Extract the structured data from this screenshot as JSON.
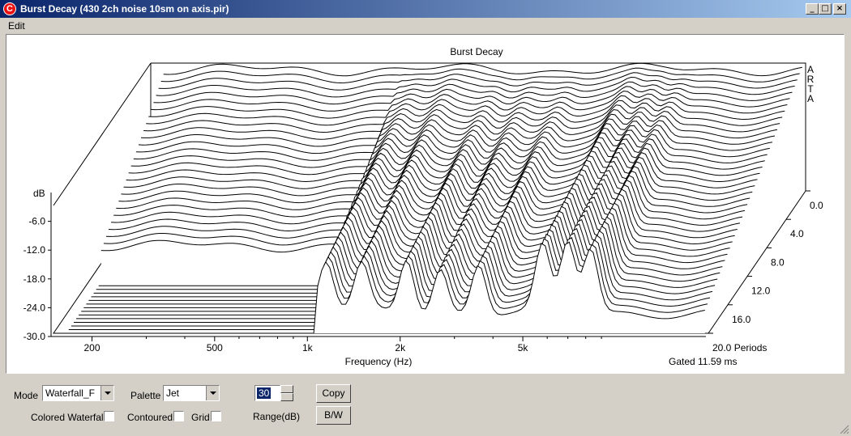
{
  "window": {
    "title": "Burst Decay  (430 2ch noise 10sm on axis.pir)",
    "icon_letter": "C",
    "minimize_glyph": "_",
    "maximize_glyph": "□",
    "close_glyph": "×"
  },
  "menu": {
    "edit": "Edit"
  },
  "chart_data": {
    "type": "waterfall",
    "title": "Burst Decay",
    "brand": [
      "A",
      "R",
      "T",
      "A"
    ],
    "ylabel": "dB",
    "xlabel": "Frequency (Hz)",
    "zlabel": "Periods",
    "gated_note": "Gated 11.59 ms",
    "y_ticks": [
      "-6.0",
      "-12.0",
      "-18.0",
      "-24.0",
      "-30.0"
    ],
    "y_values": [
      -6,
      -12,
      -18,
      -24,
      -30
    ],
    "ylim": [
      -30,
      0
    ],
    "x_scale": "log",
    "x_ticks": [
      "200",
      "500",
      "1k",
      "2k",
      "5k"
    ],
    "x_tick_values": [
      200,
      500,
      1000,
      2000,
      5000
    ],
    "z_ticks": [
      "0.0",
      "4.0",
      "8.0",
      "12.0",
      "16.0",
      "20.0"
    ],
    "z_values": [
      0,
      4,
      8,
      12,
      16,
      20
    ],
    "slices": 40
  },
  "controls": {
    "mode_label": "Mode",
    "mode_value": "Waterfall_F",
    "palette_label": "Palette",
    "palette_value": "Jet",
    "range_value": "30",
    "range_label": "Range(dB)",
    "copy_label": "Copy",
    "bw_label": "B/W",
    "colored_waterfall_label": "Colored Waterfall",
    "contoured_label": "Contoured",
    "grid_label": "Grid"
  }
}
